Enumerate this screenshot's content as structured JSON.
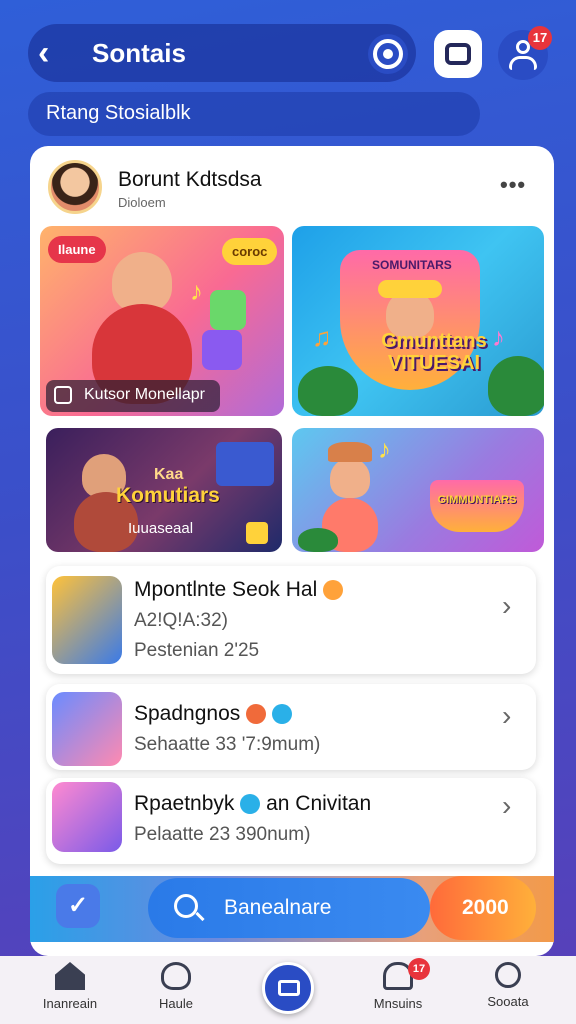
{
  "header": {
    "back_label": "‹",
    "title": "Sontais",
    "notification_count": "17",
    "icons": [
      "chevron-left-icon",
      "target-icon",
      "square-icon",
      "profile-icon"
    ]
  },
  "search": {
    "text": "Rtang Stosialblk"
  },
  "post": {
    "user_name": "Borunt Kdtsdsa",
    "user_sub": "Dioloem",
    "more": "•••",
    "tiles": [
      {
        "tag": "Ilaune",
        "bubble": "coroc",
        "caption": "Kutsor Monellapr"
      },
      {
        "title_top": "SOMUNITARS",
        "title": "Gmunttans VITUESAI"
      },
      {
        "kaa": "Kaa",
        "title": "Komutiars",
        "sub": "Iuuaseaal"
      },
      {
        "title": "GIMMUNTIARS"
      }
    ]
  },
  "list": [
    {
      "title": "Mpontlnte Seok Hal",
      "sub": "A2!Q!A:32)",
      "sub2": "Pestenian 2'25"
    },
    {
      "title": "Spadngnos",
      "sub": "Sehaatte 33 '7:9mum)"
    },
    {
      "title": "Rpaetnbyk",
      "title2": "an Cnivitan",
      "sub": "Pelaatte 23 390num)"
    }
  ],
  "cta": {
    "label": "Banealnare",
    "count": "2000"
  },
  "nav": {
    "items": [
      "Inanreain",
      "Haule",
      "Mnsuins",
      "Sooata"
    ],
    "bell_badge": "17"
  },
  "colors": {
    "primary": "#2a4cc4",
    "accent": "#ff6a3a",
    "badge": "#e8343c"
  }
}
